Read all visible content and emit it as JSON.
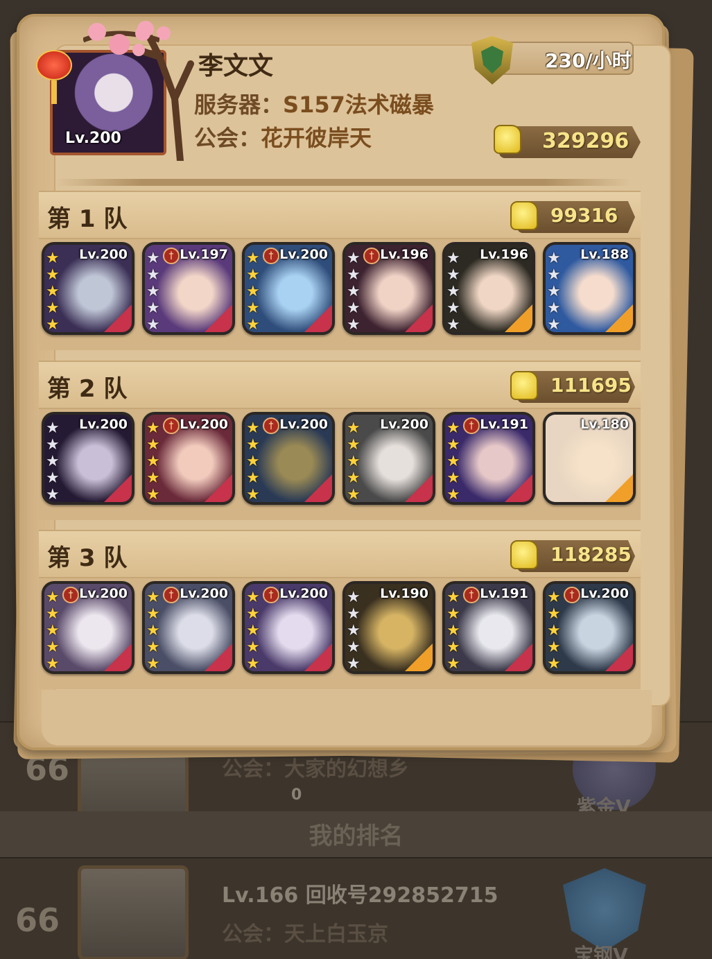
{
  "background": {
    "rows": [
      {
        "rank": "66",
        "guild": "公会：大家的幻想乡",
        "power": "0",
        "tier": "紫金V"
      },
      {
        "rank": "66",
        "title": "Lv.166 回收号292852715",
        "guild": "公会：天上白玉京",
        "tier": "宝钢V"
      }
    ],
    "my_rank_label": "我的排名"
  },
  "player": {
    "level": "Lv.200",
    "name": "李文文",
    "server_label": "服务器：",
    "server_value": "S157法术磁暴",
    "guild_label": "公会：",
    "guild_value": "花开彼岸天",
    "rate": "230/小时",
    "total_power": "329296"
  },
  "teams": [
    {
      "title": "第 1 队",
      "power": "99316",
      "heroes": [
        {
          "level": "Lv.200",
          "badge": false,
          "stars": "gold",
          "art": [
            "#3b2f55",
            "#bfc6d6"
          ],
          "corner": "#c8324a"
        },
        {
          "level": "Lv.197",
          "badge": true,
          "stars": "silver",
          "art": [
            "#5a3a7a",
            "#f2d6c8"
          ],
          "corner": "#c8324a"
        },
        {
          "level": "Lv.200",
          "badge": true,
          "stars": "gold",
          "art": [
            "#2f4d7a",
            "#a9d2f2"
          ],
          "corner": "#c8324a"
        },
        {
          "level": "Lv.196",
          "badge": true,
          "stars": "silver",
          "art": [
            "#3d2230",
            "#f1d3c6"
          ],
          "corner": "#c8324a"
        },
        {
          "level": "Lv.196",
          "badge": false,
          "stars": "silver",
          "art": [
            "#2c2a22",
            "#f0d6c4"
          ],
          "corner": "#f0a028"
        },
        {
          "level": "Lv.188",
          "badge": false,
          "stars": "silver",
          "art": [
            "#2f5aa0",
            "#f5dccd"
          ],
          "corner": "#f0a028"
        }
      ]
    },
    {
      "title": "第 2 队",
      "power": "111695",
      "heroes": [
        {
          "level": "Lv.200",
          "badge": false,
          "stars": "silver",
          "art": [
            "#251a33",
            "#c9c0d8"
          ],
          "corner": "#c8324a"
        },
        {
          "level": "Lv.200",
          "badge": true,
          "stars": "gold",
          "art": [
            "#6a2a3a",
            "#f2cbbd"
          ],
          "corner": "#c8324a"
        },
        {
          "level": "Lv.200",
          "badge": true,
          "stars": "gold",
          "art": [
            "#2a3a55",
            "#9a8a55"
          ],
          "corner": "#c8324a"
        },
        {
          "level": "Lv.200",
          "badge": false,
          "stars": "gold",
          "art": [
            "#4a4a4a",
            "#e6e0dc"
          ],
          "corner": "#c8324a"
        },
        {
          "level": "Lv.191",
          "badge": true,
          "stars": "gold",
          "art": [
            "#3a2a6a",
            "#e7c8c8"
          ],
          "corner": "#c8324a"
        },
        {
          "level": "Lv.180",
          "badge": false,
          "stars": "none",
          "art": [
            "#e8d6c2",
            "#f6e2c8"
          ],
          "corner": "#f0a028"
        }
      ]
    },
    {
      "title": "第 3 队",
      "power": "118285",
      "heroes": [
        {
          "level": "Lv.200",
          "badge": true,
          "stars": "gold",
          "art": [
            "#5a4a6a",
            "#ece6ee"
          ],
          "corner": "#c8324a"
        },
        {
          "level": "Lv.200",
          "badge": true,
          "stars": "gold",
          "art": [
            "#4a4e66",
            "#dcdde8"
          ],
          "corner": "#c8324a"
        },
        {
          "level": "Lv.200",
          "badge": true,
          "stars": "gold",
          "art": [
            "#4a3a6a",
            "#e4dcee"
          ],
          "corner": "#c8324a"
        },
        {
          "level": "Lv.190",
          "badge": false,
          "stars": "silver",
          "art": [
            "#3a3020",
            "#d6b464"
          ],
          "corner": "#f0a028"
        },
        {
          "level": "Lv.191",
          "badge": true,
          "stars": "gold",
          "art": [
            "#3c3a4a",
            "#e8e8ee"
          ],
          "corner": "#c8324a"
        },
        {
          "level": "Lv.200",
          "badge": true,
          "stars": "gold",
          "art": [
            "#2e3a4a",
            "#c8d4e0"
          ],
          "corner": "#c8324a"
        }
      ]
    }
  ],
  "colors": {
    "panel": "#d7b98c",
    "power_text": "#f7e48a",
    "title_text": "#3f2a14"
  }
}
